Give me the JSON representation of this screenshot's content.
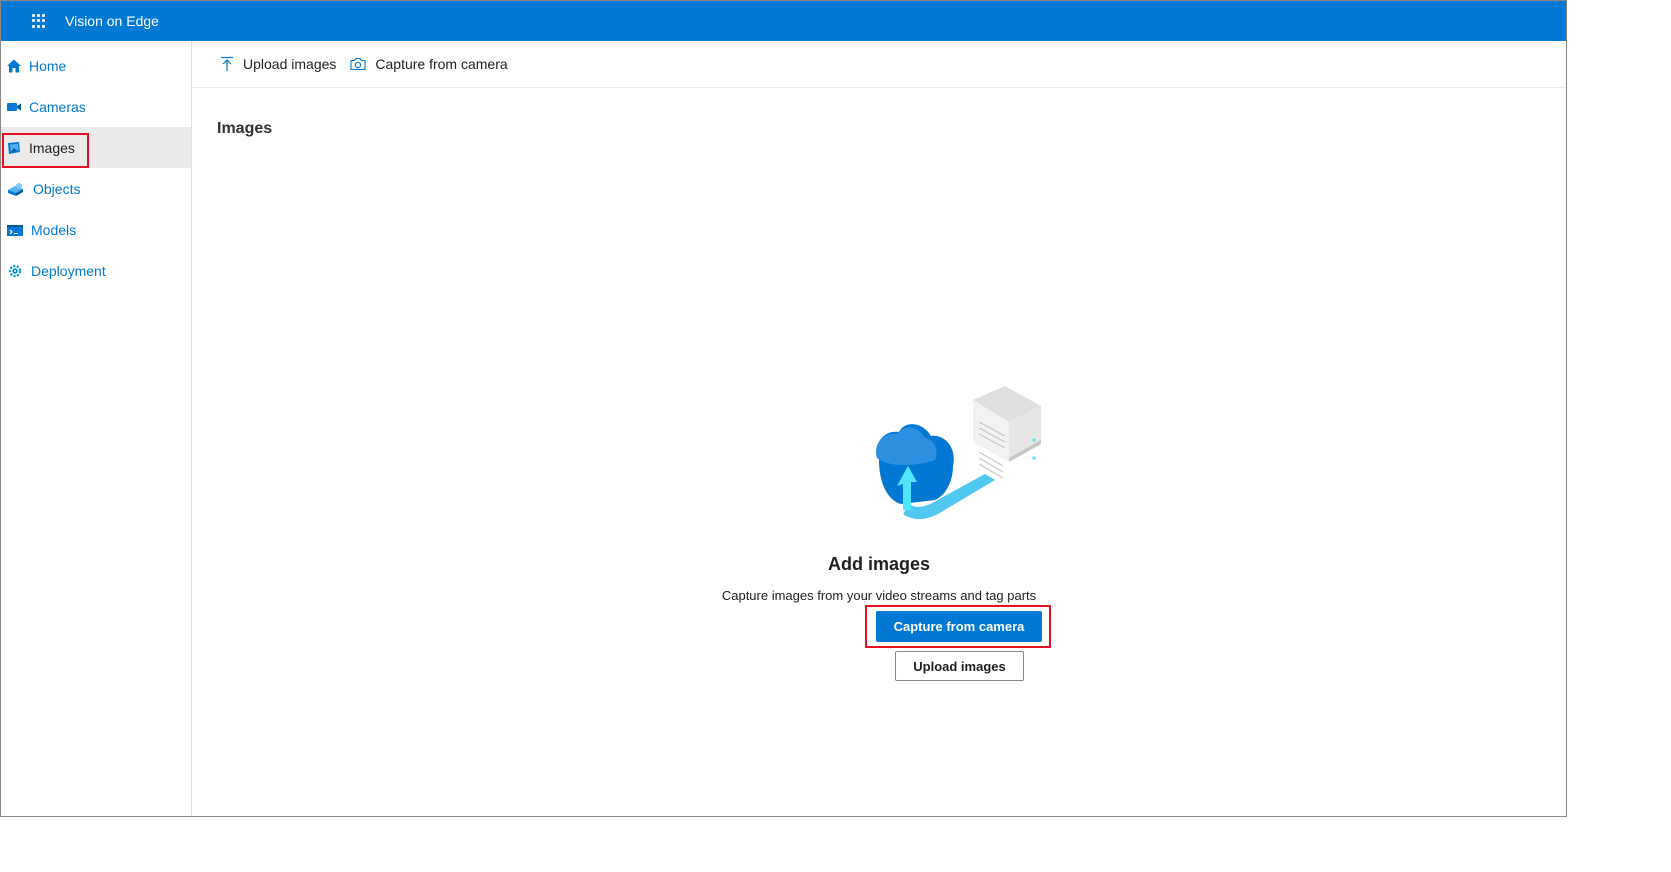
{
  "app": {
    "title": "Vision on Edge",
    "accent": "#0078d4",
    "highlight": "#e81123"
  },
  "topbar": {
    "menu_icon": "waffle-icon"
  },
  "sidebar": {
    "items": [
      {
        "label": "Home",
        "icon": "home-icon"
      },
      {
        "label": "Cameras",
        "icon": "camera-video-icon"
      },
      {
        "label": "Images",
        "icon": "images-icon",
        "active": true
      },
      {
        "label": "Objects",
        "icon": "objects-icon"
      },
      {
        "label": "Models",
        "icon": "models-icon"
      },
      {
        "label": "Deployment",
        "icon": "deployment-icon"
      }
    ]
  },
  "commandbar": {
    "upload_label": "Upload images",
    "capture_label": "Capture from camera"
  },
  "page": {
    "title": "Images"
  },
  "empty_state": {
    "title": "Add images",
    "description": "Capture images from your video streams and tag parts",
    "primary_button": "Capture from camera",
    "secondary_button": "Upload images"
  }
}
